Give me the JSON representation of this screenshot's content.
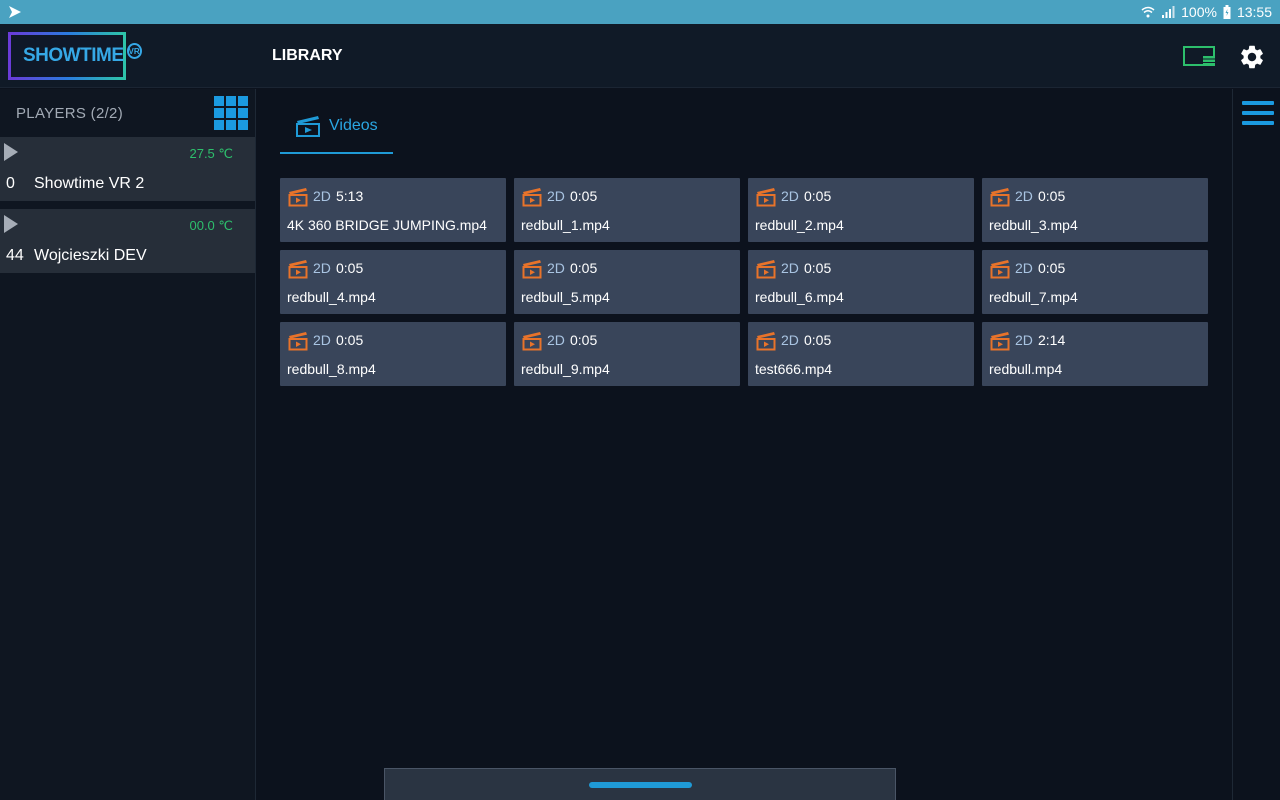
{
  "statusbar": {
    "battery": "100%",
    "time": "13:55"
  },
  "appbar": {
    "logo_text": "SHOWTIME",
    "logo_badge": "VR",
    "title": "LIBRARY",
    "cast_icon": "cast-icon",
    "settings_icon": "gear-icon"
  },
  "sidebar": {
    "title": "PLAYERS (2/2)",
    "players": [
      {
        "temp": "27.5 ℃",
        "number": "0",
        "name": "Showtime VR 2"
      },
      {
        "temp": "00.0 ℃",
        "number": "44",
        "name": "Wojcieszki DEV"
      }
    ]
  },
  "tabs": [
    {
      "label": "Videos",
      "icon": "clapperboard-icon"
    }
  ],
  "videos": [
    {
      "dim": "2D",
      "duration": "5:13",
      "name": "4K 360 BRIDGE JUMPING.mp4"
    },
    {
      "dim": "2D",
      "duration": "0:05",
      "name": "redbull_1.mp4"
    },
    {
      "dim": "2D",
      "duration": "0:05",
      "name": "redbull_2.mp4"
    },
    {
      "dim": "2D",
      "duration": "0:05",
      "name": "redbull_3.mp4"
    },
    {
      "dim": "2D",
      "duration": "0:05",
      "name": "redbull_4.mp4"
    },
    {
      "dim": "2D",
      "duration": "0:05",
      "name": "redbull_5.mp4"
    },
    {
      "dim": "2D",
      "duration": "0:05",
      "name": "redbull_6.mp4"
    },
    {
      "dim": "2D",
      "duration": "0:05",
      "name": "redbull_7.mp4"
    },
    {
      "dim": "2D",
      "duration": "0:05",
      "name": "redbull_8.mp4"
    },
    {
      "dim": "2D",
      "duration": "0:05",
      "name": "redbull_9.mp4"
    },
    {
      "dim": "2D",
      "duration": "0:05",
      "name": "test666.mp4"
    },
    {
      "dim": "2D",
      "duration": "2:14",
      "name": "redbull.mp4"
    }
  ],
  "colors": {
    "accent": "#1f9ad6",
    "temp_ok": "#2dbf6c",
    "video_icon": "#e8732a",
    "card_bg": "#39455a"
  }
}
